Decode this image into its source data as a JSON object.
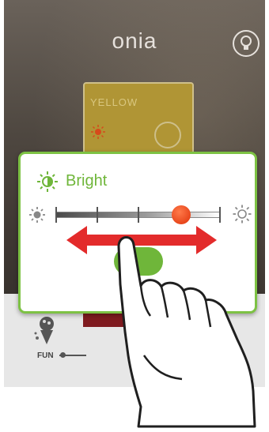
{
  "app": {
    "title": "onia"
  },
  "card": {
    "label": "YELLOW"
  },
  "bottom_bar": {
    "fun_label": "FUN"
  },
  "popup": {
    "title": "Bright"
  },
  "slider": {
    "brightness": 0.76,
    "ticks": 5
  },
  "colors": {
    "accent_green": "#7dc244",
    "thumb_orange": "#e8471c",
    "arrow_red": "#e32b2b",
    "card_yellow": "#b09535"
  },
  "icons": {
    "bulb": "bulb-icon",
    "card_sun": "sun-icon",
    "popup_title": "brightness-icon",
    "dim": "sun-dim-icon",
    "bright": "sun-bright-icon",
    "fun": "fun-icon",
    "arrow": "double-arrow-icon",
    "hand": "hand-pointer-icon"
  }
}
